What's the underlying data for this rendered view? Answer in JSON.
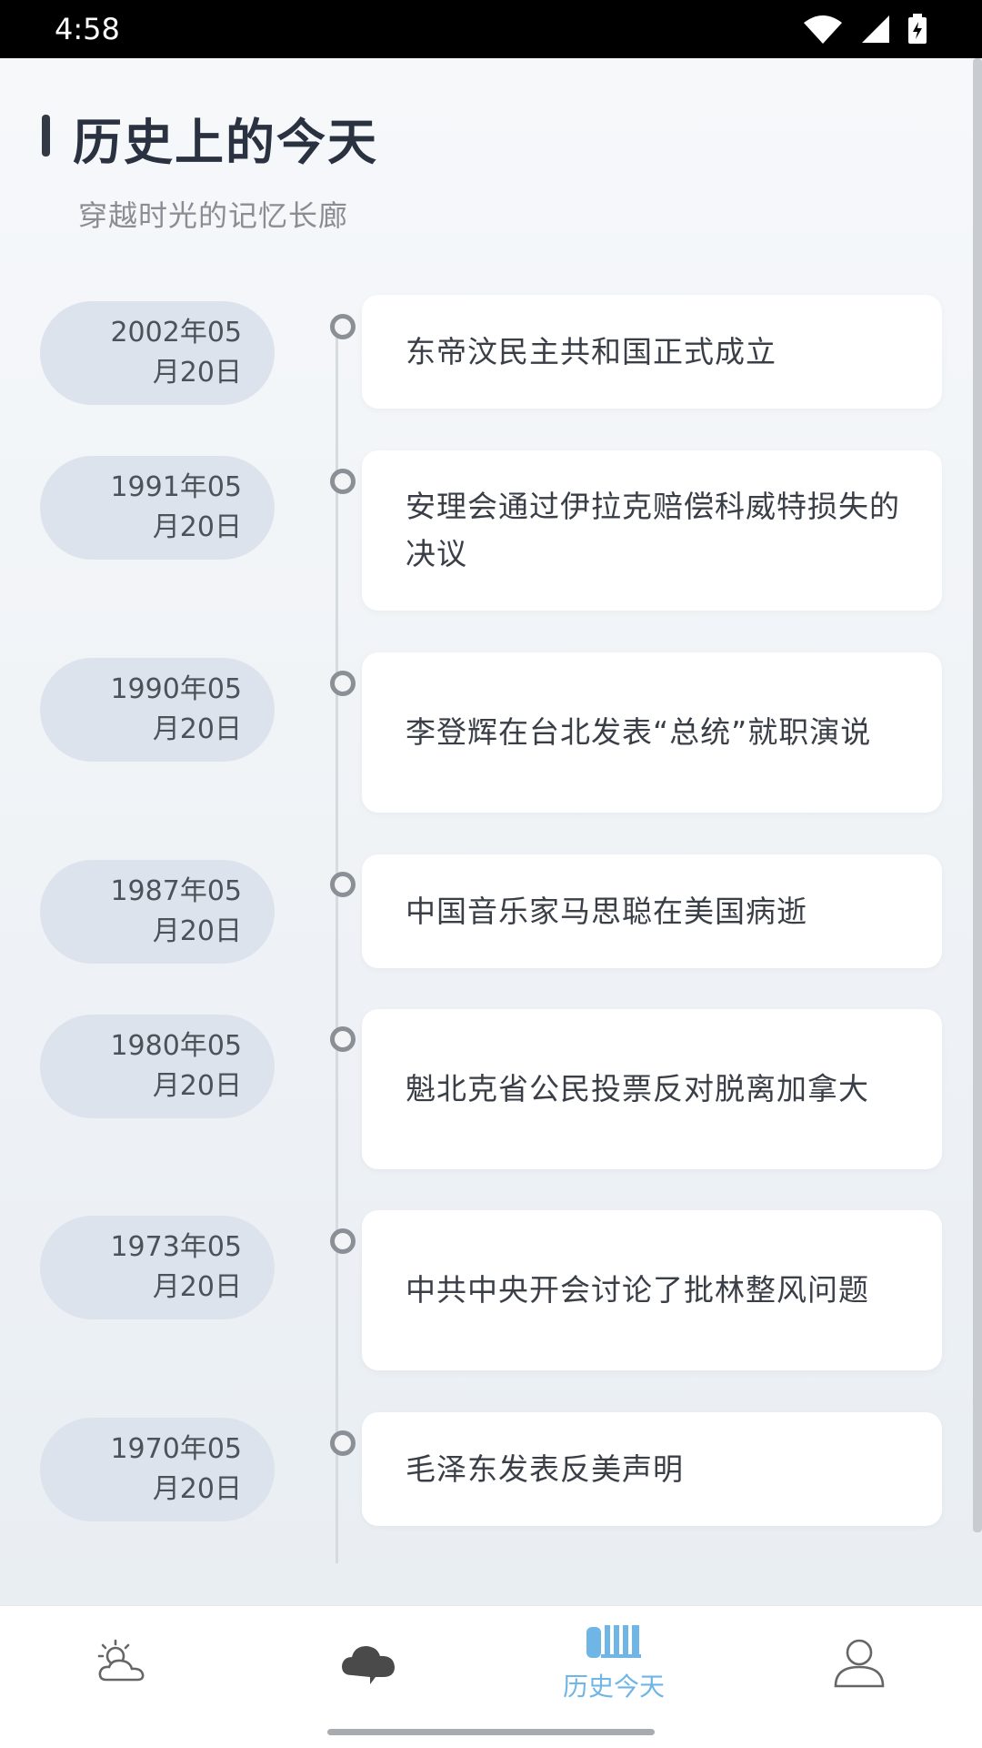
{
  "status": {
    "time": "4:58"
  },
  "header": {
    "title": "历史上的今天",
    "subtitle": "穿越时光的记忆长廊"
  },
  "events": [
    {
      "date_line1": "2002年05",
      "date_line2": "月20日",
      "text": "东帝汶民主共和国正式成立"
    },
    {
      "date_line1": "1991年05",
      "date_line2": "月20日",
      "text": "安理会通过伊拉克赔偿科威特损失的决议"
    },
    {
      "date_line1": "1990年05",
      "date_line2": "月20日",
      "text": "李登辉在台北发表“总统”就职演说"
    },
    {
      "date_line1": "1987年05",
      "date_line2": "月20日",
      "text": "中国音乐家马思聪在美国病逝"
    },
    {
      "date_line1": "1980年05",
      "date_line2": "月20日",
      "text": "魁北克省公民投票反对脱离加拿大"
    },
    {
      "date_line1": "1973年05",
      "date_line2": "月20日",
      "text": "中共中央开会讨论了批林整风问题"
    },
    {
      "date_line1": "1970年05",
      "date_line2": "月20日",
      "text": "毛泽东发表反美声明"
    }
  ],
  "nav": {
    "items": [
      {
        "icon": "weather-sun-cloud-icon"
      },
      {
        "icon": "cloud-icon"
      },
      {
        "icon": "history-book-icon",
        "label": "历史今天",
        "active": true
      },
      {
        "icon": "user-profile-icon"
      }
    ],
    "active_color": "#6fb6e6"
  }
}
